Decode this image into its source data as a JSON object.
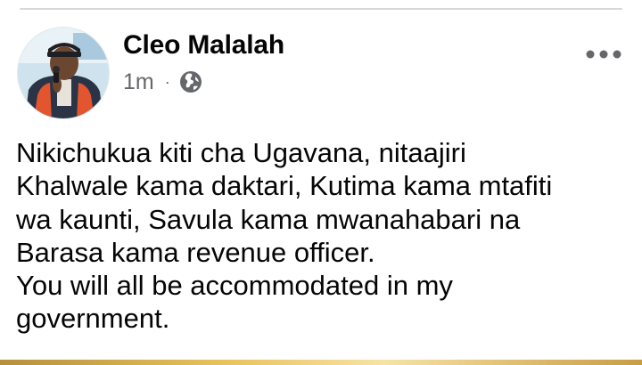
{
  "post": {
    "author": "Cleo Malalah",
    "time": "1m",
    "separator": "·",
    "audience_icon": "globe-icon",
    "more_icon": "more-options-icon",
    "body": "Nikichukua kiti cha Ugavana, nitaajiri\nKhalwale kama daktari, Kutima kama mtafiti\nwa kaunti, Savula kama mwanahabari na\nBarasa kama revenue officer.\nYou will all be accommodated in my\ngovernment."
  },
  "colors": {
    "name_text": "#050505",
    "meta_text": "#65676b",
    "divider": "#d6d7da"
  }
}
